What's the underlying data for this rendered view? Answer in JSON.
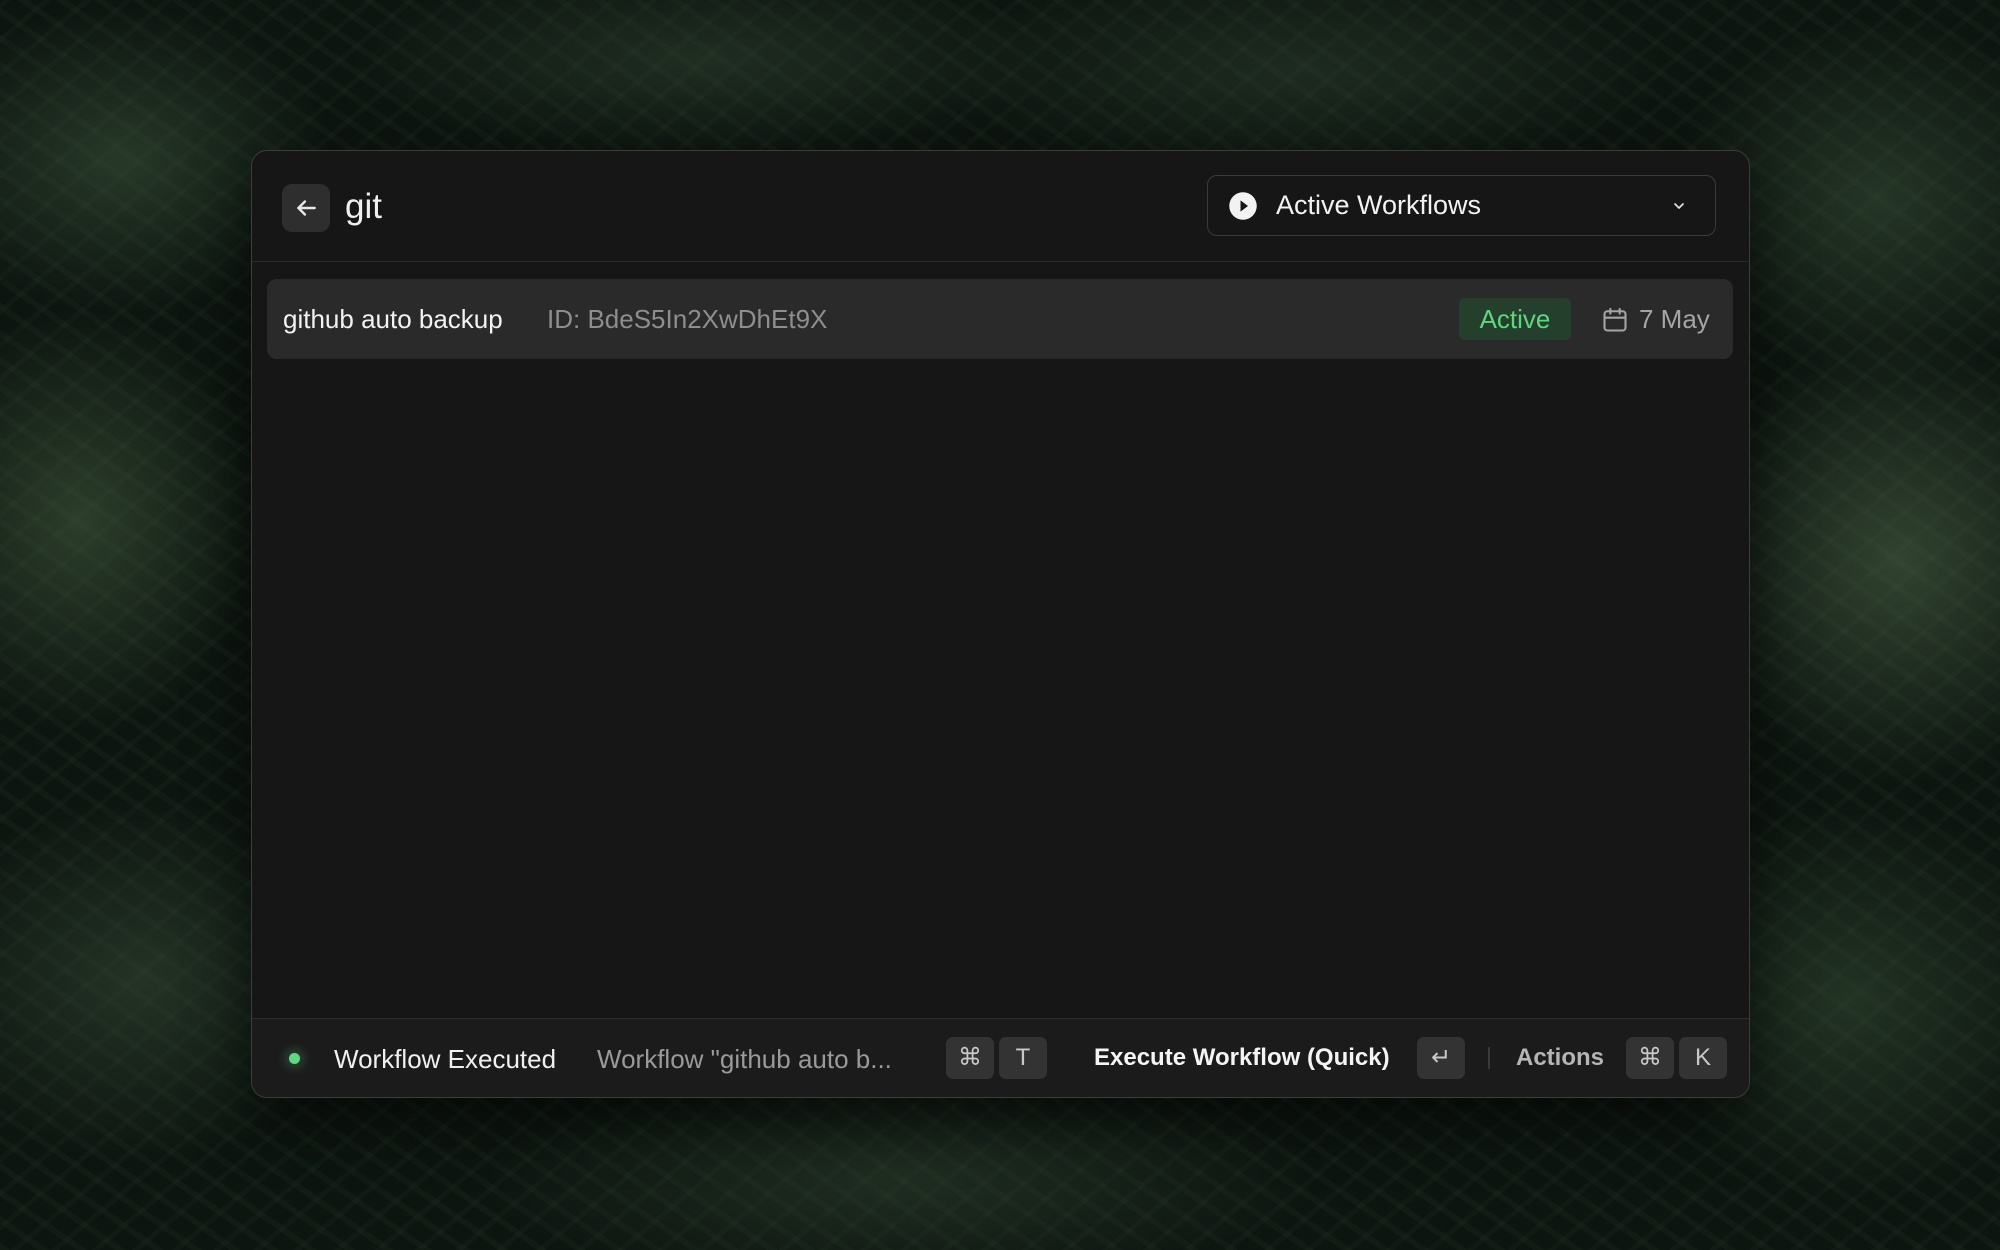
{
  "header": {
    "search_value": "git",
    "filter_label": "Active Workflows",
    "filter_icon": "play-circle-icon"
  },
  "results": [
    {
      "title": "github auto backup",
      "id": "ID: BdeS5In2XwDhEt9X",
      "status": "Active",
      "date": "7 May"
    }
  ],
  "footer": {
    "status_title": "Workflow Executed",
    "status_message": "Workflow \"github auto b...",
    "toast_shortcut": [
      "⌘",
      "T"
    ],
    "primary_action": "Execute Workflow (Quick)",
    "primary_shortcut": "↵",
    "actions_label": "Actions",
    "actions_shortcut": [
      "⌘",
      "K"
    ]
  },
  "colors": {
    "accent_green": "#5ed67e",
    "badge_bg": "#24402c",
    "window_bg": "#161616"
  }
}
